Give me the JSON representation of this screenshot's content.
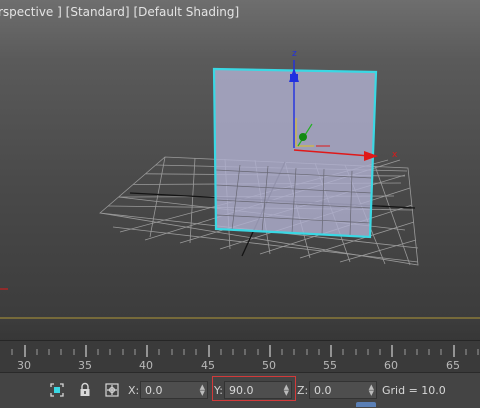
{
  "viewport": {
    "label_view": "rspective ]",
    "label_mode": "[Standard]",
    "label_shading": "[Default Shading]",
    "axis_z": "z",
    "axis_x": "x",
    "colors": {
      "selection": "#3ad8e4",
      "plane_fill": "#b0b0cf",
      "grid": "#9a9a9a",
      "axis_x": "#e01818",
      "axis_y": "#20b020",
      "axis_z": "#2030e0"
    }
  },
  "trackbar": {
    "tick_labels": [
      "30",
      "35",
      "40",
      "45",
      "50",
      "55",
      "60",
      "65"
    ]
  },
  "statusbar": {
    "x_label": "X:",
    "x_value": "0.0",
    "y_label": "Y:",
    "y_value": "90.0",
    "z_label": "Z:",
    "z_value": "0.0",
    "grid": "Grid = 10.0",
    "icons": [
      "selection-lock-icon",
      "padlock-icon",
      "absolute-offset-mode-icon"
    ]
  }
}
